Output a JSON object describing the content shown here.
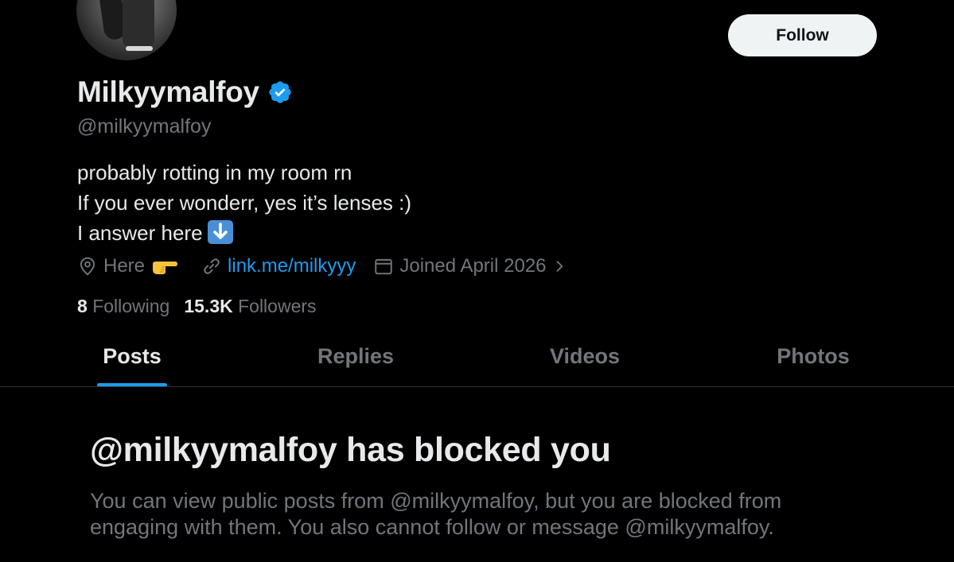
{
  "profile": {
    "display_name": "Milkyymalfoy",
    "handle": "@milkyymalfoy",
    "verified": true,
    "follow_label": "Follow",
    "bio_lines": [
      "probably rotting in my room rn",
      "If you ever wonderr, yes it’s lenses :)",
      "I answer here"
    ],
    "bio_emoji": "down-arrow-emoji",
    "location": "Here",
    "location_emoji": "backhand-index-pointing-right-emoji",
    "link": "link.me/milkyyy",
    "joined": "Joined April 2026",
    "following_count": "8",
    "following_label": "Following",
    "followers_count": "15.3K",
    "followers_label": "Followers"
  },
  "tabs": [
    {
      "label": "Posts",
      "active": true
    },
    {
      "label": "Replies",
      "active": false
    },
    {
      "label": "Videos",
      "active": false
    },
    {
      "label": "Photos",
      "active": false
    }
  ],
  "blocked": {
    "title": "@milkyymalfoy has blocked you",
    "description": "You can view public posts from @milkyymalfoy, but you are blocked from engaging with them. You also cannot follow or message @milkyymalfoy."
  },
  "colors": {
    "background": "#000000",
    "primary_text": "#e7e9ea",
    "secondary_text": "#71767b",
    "accent": "#1d9bf0",
    "follow_button": "#eff3f4"
  }
}
